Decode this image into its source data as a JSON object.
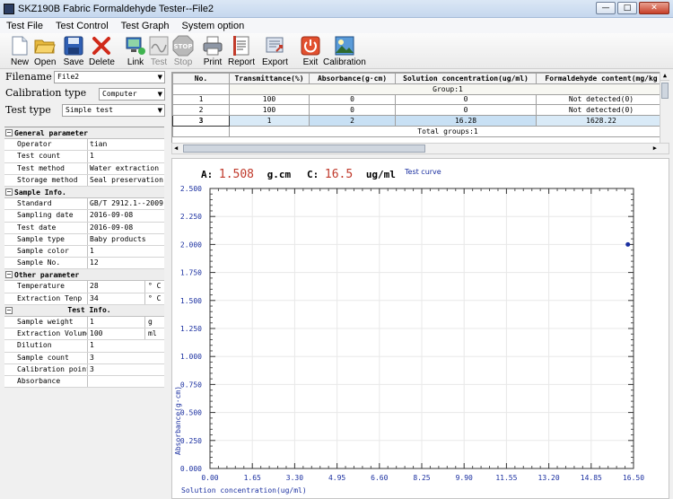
{
  "window": {
    "title": "SKZ190B Fabric Formaldehyde Tester--File2"
  },
  "menu": [
    "Test File",
    "Test Control",
    "Test Graph",
    "System option"
  ],
  "toolbar": [
    {
      "label": "New",
      "icon": "new-file-icon",
      "enabled": true
    },
    {
      "label": "Open",
      "icon": "open-folder-icon",
      "enabled": true
    },
    {
      "label": "Save",
      "icon": "save-disk-icon",
      "enabled": true
    },
    {
      "label": "Delete",
      "icon": "delete-x-icon",
      "enabled": true
    },
    {
      "label": "Link",
      "icon": "link-computer-icon",
      "enabled": true
    },
    {
      "label": "Test",
      "icon": "test-wave-icon",
      "enabled": false
    },
    {
      "label": "Stop",
      "icon": "stop-sign-icon",
      "enabled": false
    },
    {
      "label": "Print",
      "icon": "printer-icon",
      "enabled": true
    },
    {
      "label": "Report",
      "icon": "report-doc-icon",
      "enabled": true
    },
    {
      "label": "Export",
      "icon": "export-icon",
      "enabled": true
    },
    {
      "label": "Exit",
      "icon": "exit-power-icon",
      "enabled": true
    },
    {
      "label": "Calibration",
      "icon": "calibration-picture-icon",
      "enabled": true
    }
  ],
  "left": {
    "filename_label": "Filename",
    "filename_value": "File2",
    "calib_label": "Calibration type",
    "calib_value": "Computer",
    "testtype_label": "Test type",
    "testtype_value": "Simple test"
  },
  "params": [
    {
      "header": "General parameter",
      "align": "left",
      "rows": [
        {
          "k": "Operator",
          "v": "tian"
        },
        {
          "k": "Test count",
          "v": "1"
        },
        {
          "k": "Test method",
          "v": "Water extraction"
        },
        {
          "k": "Storage method",
          "v": "Seal preservation"
        }
      ]
    },
    {
      "header": "Sample Info.",
      "align": "left",
      "rows": [
        {
          "k": "Standard",
          "v": "GB/T 2912.1--2009"
        },
        {
          "k": "Sampling date",
          "v": "2016-09-08"
        },
        {
          "k": "Test date",
          "v": "2016-09-08"
        },
        {
          "k": "Sample type",
          "v": "Baby products"
        },
        {
          "k": "Sample color",
          "v": "1"
        },
        {
          "k": "Sample No.",
          "v": "12"
        }
      ]
    },
    {
      "header": "Other parameter",
      "align": "left",
      "rows": [
        {
          "k": "Temperature",
          "v": "28",
          "u": "° C"
        },
        {
          "k": "Extraction Tenp",
          "v": "34",
          "u": "° C"
        }
      ]
    },
    {
      "header": "Test Info.",
      "align": "center",
      "rows": [
        {
          "k": "Sample weight",
          "v": "1",
          "u": "g"
        },
        {
          "k": "Extraction Volume",
          "v": "100",
          "u": "ml"
        },
        {
          "k": "Dilution",
          "v": "1"
        },
        {
          "k": "Sample count",
          "v": "3"
        },
        {
          "k": "Calibration points",
          "v": "3"
        },
        {
          "k": "Absorbance",
          "v": ""
        }
      ]
    }
  ],
  "table": {
    "columns": [
      "No.",
      "Transmittance(%)",
      "Absorbance(g·cm)",
      "Solution concentration(ug/ml)",
      "Formaldehyde content(mg/kg"
    ],
    "group_label": "Group:1",
    "rows": [
      [
        "1",
        "100",
        "0",
        "0",
        "Not detected(0)"
      ],
      [
        "2",
        "100",
        "0",
        "0",
        "Not detected(0)"
      ],
      [
        "3",
        "1",
        "2",
        "16.28",
        "1628.22"
      ]
    ],
    "total_label": "Total groups:1"
  },
  "readout": {
    "a_label": "A:",
    "a_value": "1.508",
    "a_unit": "g.cm",
    "c_label": "C:",
    "c_value": "16.5",
    "c_unit": "ug/ml",
    "curve_label": "Test curve"
  },
  "chart_data": {
    "type": "scatter",
    "xlabel": "Solution concentration(ug/ml)",
    "ylabel": "Absorbance(g·cm)",
    "xlim": [
      0,
      16.5
    ],
    "ylim": [
      0,
      2.5
    ],
    "xticks": [
      "0.00",
      "1.65",
      "3.30",
      "4.95",
      "6.60",
      "8.25",
      "9.90",
      "11.55",
      "13.20",
      "14.85",
      "16.50"
    ],
    "yticks": [
      "0.000",
      "0.250",
      "0.500",
      "0.750",
      "1.000",
      "1.250",
      "1.500",
      "1.750",
      "2.000",
      "2.250",
      "2.500"
    ],
    "points": [
      {
        "x": 16.28,
        "y": 2.0
      }
    ],
    "grid": true,
    "point_color": "#1a2fa0"
  }
}
